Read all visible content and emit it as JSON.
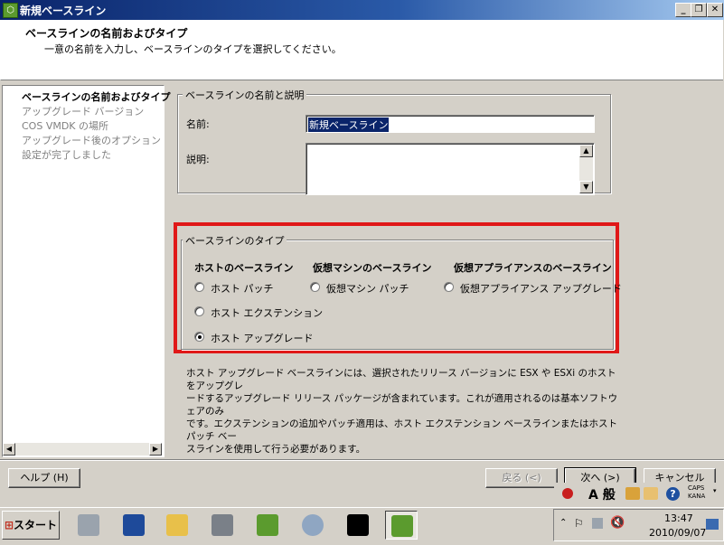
{
  "window": {
    "title": "新規ベースライン"
  },
  "header": {
    "title": "ベースラインの名前およびタイプ",
    "subtitle": "一意の名前を入力し、ベースラインのタイプを選択してください。"
  },
  "nav": {
    "items": [
      {
        "label": "ベースラインの名前およびタイプ",
        "active": true
      },
      {
        "label": "アップグレード バージョン",
        "active": false
      },
      {
        "label": "COS VMDK の場所",
        "active": false
      },
      {
        "label": "アップグレード後のオプション",
        "active": false
      },
      {
        "label": "設定が完了しました",
        "active": false
      }
    ]
  },
  "name_group": {
    "legend": "ベースラインの名前と説明",
    "name_label": "名前:",
    "name_value": "新規ベースライン",
    "desc_label": "説明:",
    "desc_value": ""
  },
  "type_group": {
    "legend": "ベースラインのタイプ",
    "columns": [
      {
        "heading": "ホストのベースライン"
      },
      {
        "heading": "仮想マシンのベースライン"
      },
      {
        "heading": "仮想アプライアンスのベースライン"
      }
    ],
    "options": [
      {
        "label": "ホスト パッチ",
        "checked": false
      },
      {
        "label": "ホスト エクステンション",
        "checked": false
      },
      {
        "label": "ホスト アップグレード",
        "checked": true
      },
      {
        "label": "仮想マシン パッチ",
        "checked": false
      },
      {
        "label": "仮想アプライアンス アップグレード",
        "checked": false
      }
    ]
  },
  "info": {
    "line1": "ホスト アップグレード ベースラインには、選択されたリリース バージョンに ESX や ESXi のホストをアップグレ",
    "line2": "ードするアップグレード リリース パッケージが含まれています。これが適用されるのは基本ソフトウェアのみ",
    "line3": "です。エクステンションの追加やパッチ適用は、ホスト エクステンション ベースラインまたはホスト パッチ ベー",
    "line4": "スラインを使用して行う必要があります。"
  },
  "buttons": {
    "help": "ヘルプ (H)",
    "back": "戻る (<)",
    "next": "次へ (>)",
    "cancel": "キャンセル"
  },
  "language_bar": {
    "ime_mode": "A 般",
    "caps": "CAPS",
    "kana": "KANA"
  },
  "taskbar": {
    "start": "スタート",
    "icons": [
      "server-manager-icon",
      "powershell-icon",
      "explorer-icon",
      "tools-icon",
      "vsphere-client-icon",
      "services-icon",
      "command-prompt-icon",
      "vsphere-client-active-icon"
    ]
  },
  "clock": {
    "time": "13:47",
    "date": "2010/09/07"
  }
}
